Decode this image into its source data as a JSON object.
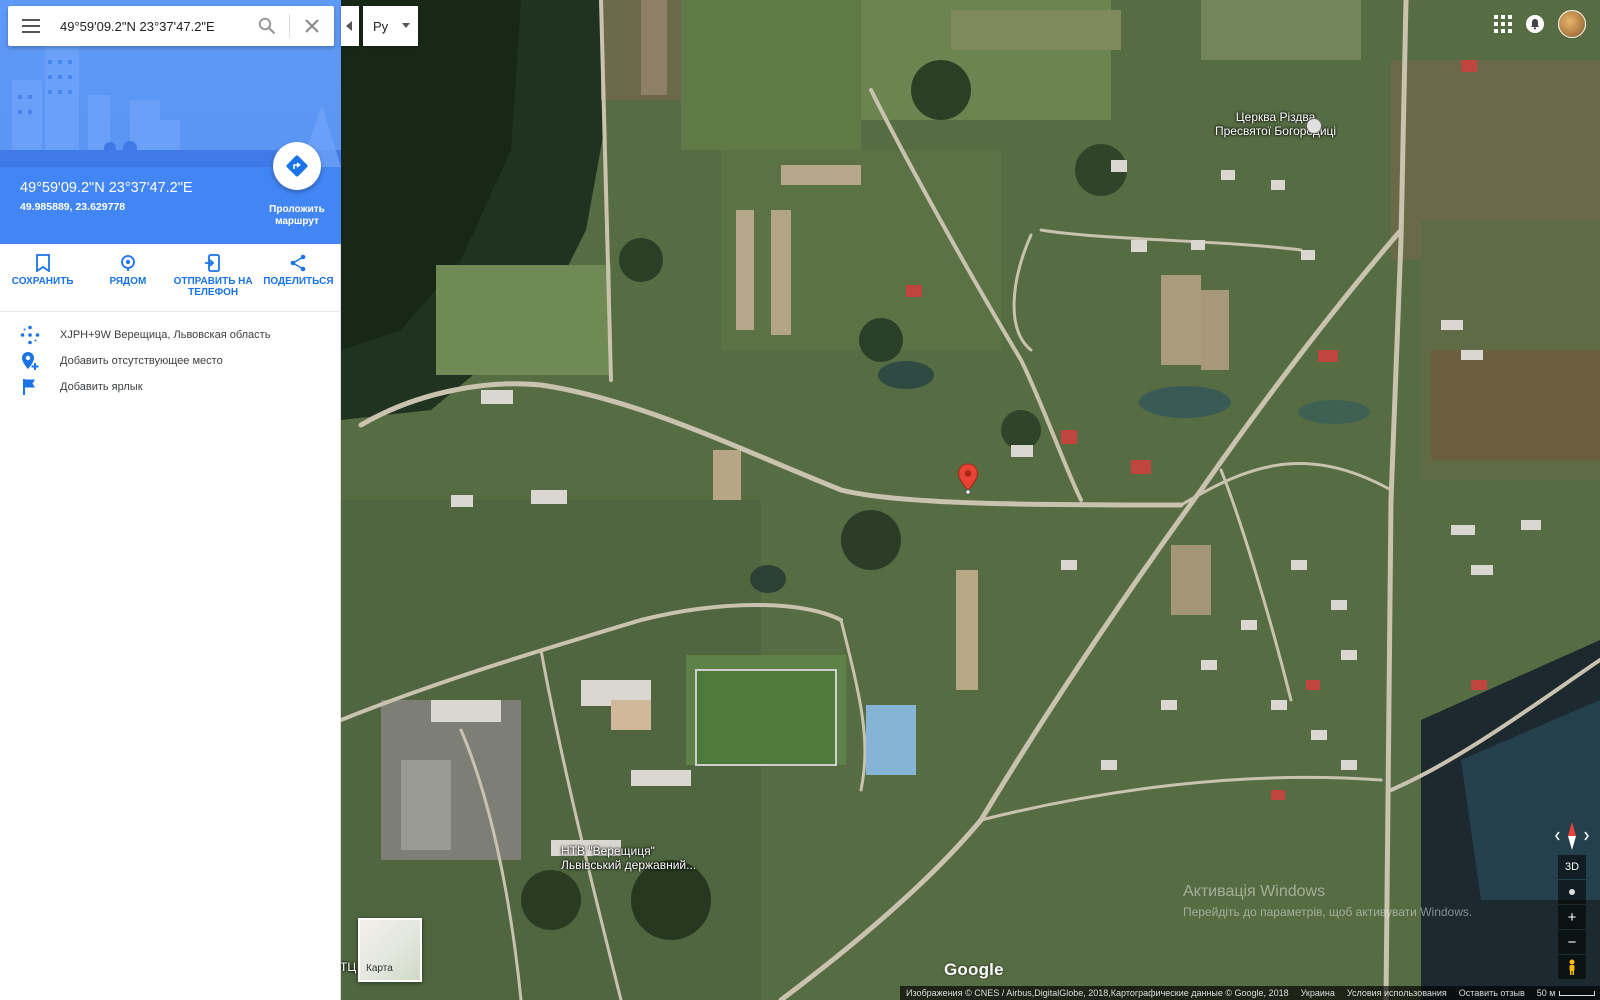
{
  "search": {
    "value": "49°59'09.2\"N 23°37'47.2\"E",
    "menu_icon": "hamburger-icon",
    "search_icon": "search-icon",
    "close_icon": "close-icon"
  },
  "place": {
    "title": "49°59'09.2\"N 23°37'47.2\"E",
    "decimal": "49.985889, 23.629778",
    "route_label_line1": "Проложить",
    "route_label_line2": "маршрут"
  },
  "actions": [
    {
      "label": "СОХРАНИТЬ",
      "icon": "bookmark-icon"
    },
    {
      "label": "РЯДОМ",
      "icon": "nearby-icon"
    },
    {
      "label": "ОТПРАВИТЬ НА ТЕЛЕФОН",
      "icon": "send-to-phone-icon"
    },
    {
      "label": "ПОДЕЛИТЬСЯ",
      "icon": "share-icon"
    }
  ],
  "info": [
    {
      "text": "XJPH+9W Верещица, Львовская область",
      "icon": "plus-code-icon"
    },
    {
      "text": "Добавить отсутствующее место",
      "icon": "add-place-icon"
    },
    {
      "text": "Добавить ярлык",
      "icon": "flag-icon"
    }
  ],
  "map": {
    "language": "Ру",
    "church_label_1": "Церква Різдва",
    "church_label_2": "Пресвятої Богородиці",
    "school_label_1": "НТВ \"Верещиця\"",
    "school_label_2": "Львівський державний...",
    "edge_label": "ТЦ",
    "watermark_1": "Активація Windows",
    "watermark_2": "Перейдіть до параметрів, щоб активувати Windows.",
    "google": "Google",
    "layer_label": "Карта",
    "ctrl_3d": "3D",
    "zoom_in": "+",
    "zoom_out": "−",
    "colors": {
      "accent": "#1a73e8",
      "header": "#4285f4",
      "pin": "#ea4335"
    }
  },
  "footer": {
    "imagery": "Изображения © CNES / Airbus,DigitalGlobe, 2018,Картографические данные © Google, 2018",
    "country": "Украина",
    "terms": "Условия использования",
    "feedback": "Оставить отзыв",
    "scale": "50 м"
  }
}
